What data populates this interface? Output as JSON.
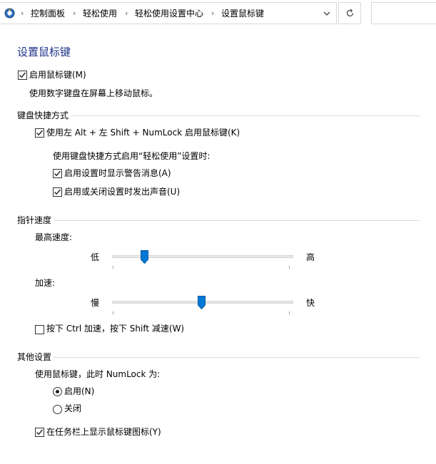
{
  "breadcrumb": {
    "items": [
      "控制面板",
      "轻松使用",
      "轻松使用设置中心",
      "设置鼠标键"
    ],
    "separator": "›"
  },
  "page": {
    "title": "设置鼠标键",
    "enable_mousekeys_label": "启用鼠标键(M)",
    "enable_mousekeys_checked": true,
    "enable_mousekeys_desc": "使用数字键盘在屏幕上移动鼠标。"
  },
  "shortcut": {
    "header": "键盘快捷方式",
    "enable_shortcut_label": "使用左 Alt + 左 Shift + NumLock 启用鼠标键(K)",
    "enable_shortcut_checked": true,
    "when_label": "使用键盘快捷方式启用“轻松使用”设置时:",
    "warning_label": "启用设置时显示警告消息(A)",
    "warning_checked": true,
    "sound_label": "启用或关闭设置时发出声音(U)",
    "sound_checked": true
  },
  "pointer": {
    "header": "指针速度",
    "top_speed_label": "最高速度:",
    "top_speed_low": "低",
    "top_speed_high": "高",
    "top_speed_value": 0.18,
    "accel_label": "加速:",
    "accel_low": "慢",
    "accel_high": "快",
    "accel_value": 0.5,
    "ctrl_shift_label": "按下 Ctrl 加速，按下 Shift 减速(W)",
    "ctrl_shift_checked": false
  },
  "other": {
    "header": "其他设置",
    "numlock_label": "使用鼠标键，此时 NumLock 为:",
    "on_label": "启用(N)",
    "off_label": "关闭",
    "selected": "on",
    "taskbar_label": "在任务栏上显示鼠标键图标(Y)",
    "taskbar_checked": true
  },
  "colors": {
    "title": "#1e3287",
    "accent": "#0078d7"
  }
}
